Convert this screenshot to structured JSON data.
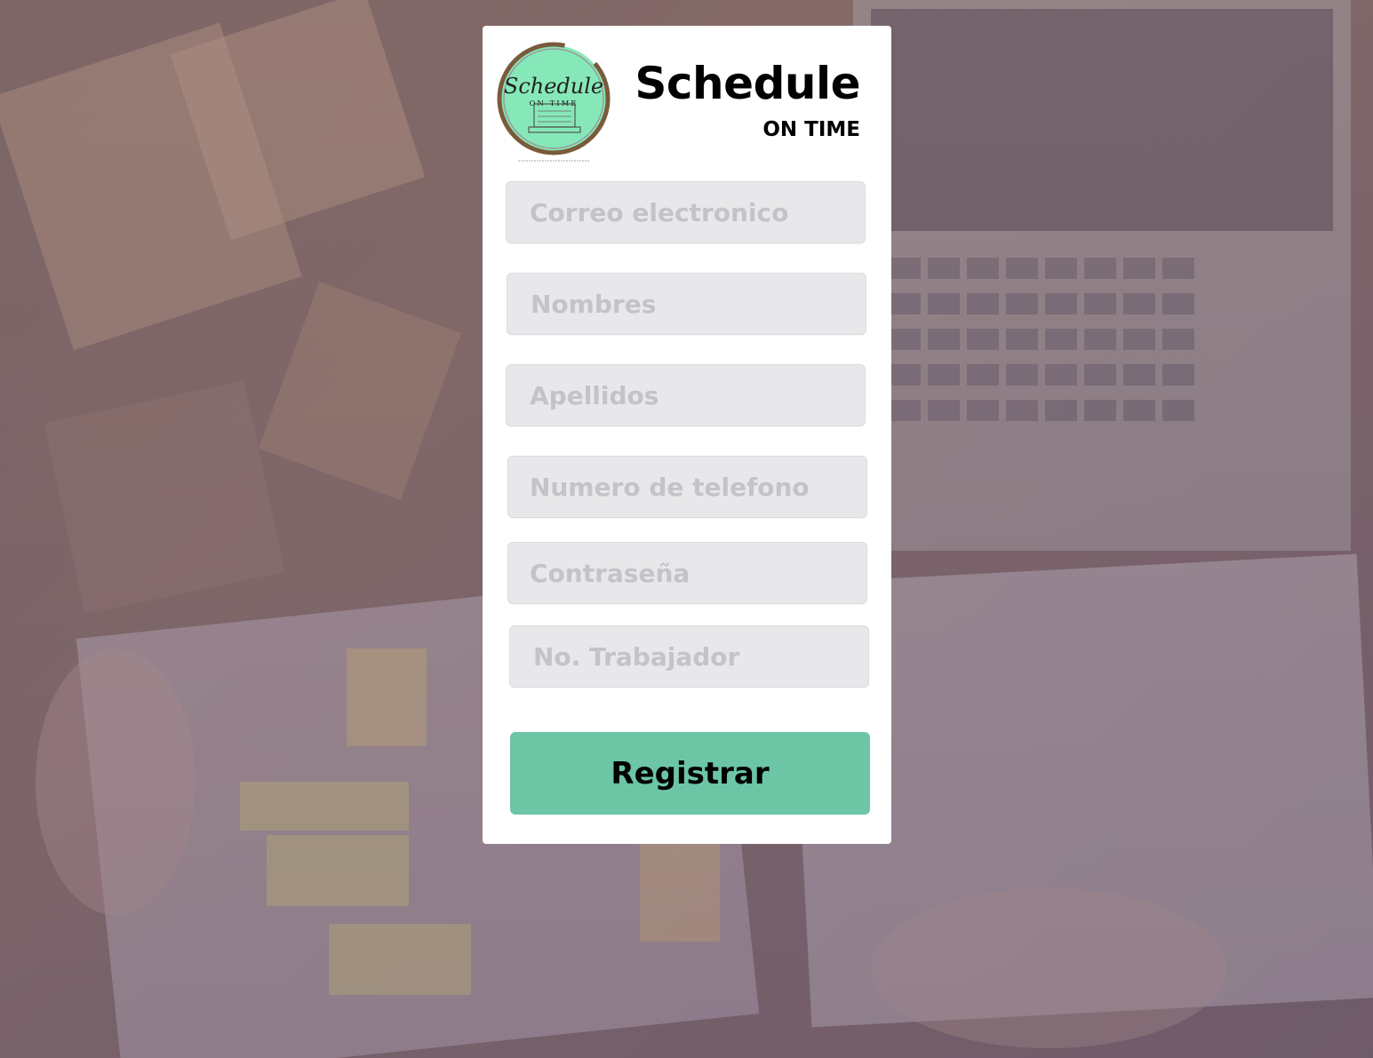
{
  "brand": {
    "title": "Schedule",
    "subtitle": "ON TIME",
    "logo_script": "Schedule",
    "logo_band": "ON TIME",
    "logo_ring_color": "#7a5a3a",
    "logo_fill_color": "#86e8b8"
  },
  "form": {
    "fields": [
      {
        "name": "email",
        "placeholder": "Correo electronico",
        "value": ""
      },
      {
        "name": "first_names",
        "placeholder": "Nombres",
        "value": ""
      },
      {
        "name": "last_names",
        "placeholder": "Apellidos",
        "value": ""
      },
      {
        "name": "phone",
        "placeholder": "Numero de telefono",
        "value": ""
      },
      {
        "name": "password",
        "placeholder": "Contraseña",
        "value": ""
      },
      {
        "name": "worker_number",
        "placeholder": "No. Trabajador",
        "value": ""
      }
    ],
    "submit_label": "Registrar"
  },
  "colors": {
    "accent": "#6cc6a6",
    "field_bg": "#e8e8ea",
    "placeholder": "#c3c3c8",
    "card_bg": "#ffffff"
  }
}
